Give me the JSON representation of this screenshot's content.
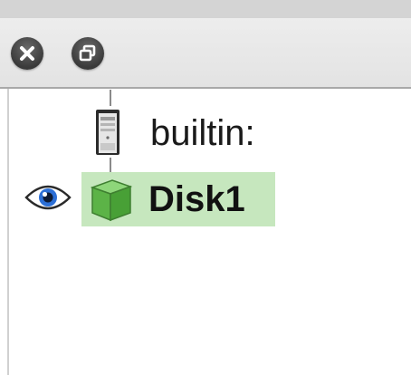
{
  "toolbar": {
    "close_icon": "close-icon",
    "restore_icon": "restore-window-icon"
  },
  "tree": {
    "builtin": {
      "label": "builtin:",
      "icon": "server-tower-icon"
    },
    "disk": {
      "label": "Disk1",
      "icon": "green-cube-icon",
      "visibility_icon": "eye-icon",
      "selected": true
    }
  },
  "colors": {
    "selection_background": "#c6e7be",
    "toolbar_background": "#e8e8e8",
    "cube_green": "#5cb347"
  }
}
